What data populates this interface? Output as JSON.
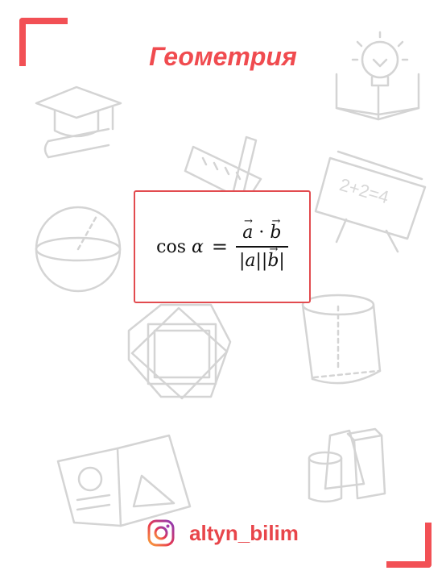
{
  "title": "Геометрия",
  "formula": {
    "lhs_func": "cos",
    "lhs_var": "α",
    "equals": "=",
    "num_a": "a",
    "num_dot": "·",
    "num_b": "b",
    "den_a": "|a||",
    "den_b": "b",
    "den_close": "|",
    "arrow": "→"
  },
  "footer": {
    "handle": "altyn_bilim",
    "icon": "instagram-icon"
  },
  "decor_text": "2+2=4",
  "colors": {
    "accent": "#f25055",
    "box_border": "#e24b4f",
    "doodle": "#d4d4d4"
  }
}
